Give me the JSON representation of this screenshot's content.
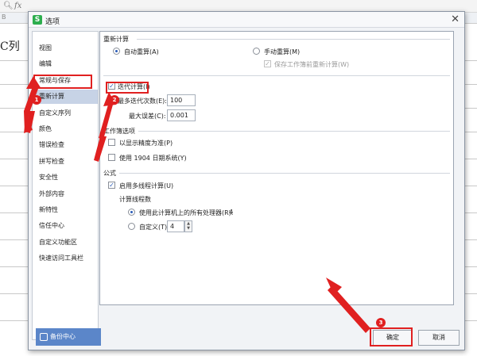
{
  "background": {
    "formula_icons": [
      "search-icon",
      "fx"
    ],
    "column_label": "B",
    "cell_text": "C列"
  },
  "dialog": {
    "title": "选项",
    "app_icon": "S",
    "sidebar": [
      {
        "label": "视图"
      },
      {
        "label": "编辑"
      },
      {
        "label": "常规与保存"
      },
      {
        "label": "重新计算",
        "active": true
      },
      {
        "label": "自定义序列"
      },
      {
        "label": "颜色"
      },
      {
        "label": "错误检查"
      },
      {
        "label": "拼写检查"
      },
      {
        "label": "安全性"
      },
      {
        "label": "外部内容"
      },
      {
        "label": "新特性"
      },
      {
        "label": "信任中心"
      },
      {
        "label": "自定义功能区"
      },
      {
        "label": "快速访问工具栏"
      }
    ],
    "backup_label": "备份中心",
    "recalc": {
      "section_title": "重新计算",
      "auto_label": "自动重算(A)",
      "manual_label": "手动重算(M)",
      "save_recalc_label": "保存工作簿前重新计算(W)",
      "iter_label": "迭代计算(I)",
      "max_iter_label": "最多迭代次数(E):",
      "max_iter_value": "100",
      "max_change_label": "最大误差(C):",
      "max_change_value": "0.001"
    },
    "workbook": {
      "section_title": "工作簿选项",
      "precision_label": "以显示精度为准(P)",
      "date1904_label": "使用 1904 日期系统(Y)"
    },
    "formula": {
      "section_title": "公式",
      "multithread_label": "启用多线程计算(U)",
      "threads_title": "计算线程数",
      "all_proc_label": "使用此计算机上的所有处理器(R):",
      "all_proc_count": "4",
      "custom_label": "自定义(T)",
      "custom_value": "4"
    },
    "ok_label": "确定",
    "cancel_label": "取消"
  },
  "annotations": {
    "badges": [
      "1",
      "2",
      "3"
    ],
    "color": "#e02020"
  }
}
